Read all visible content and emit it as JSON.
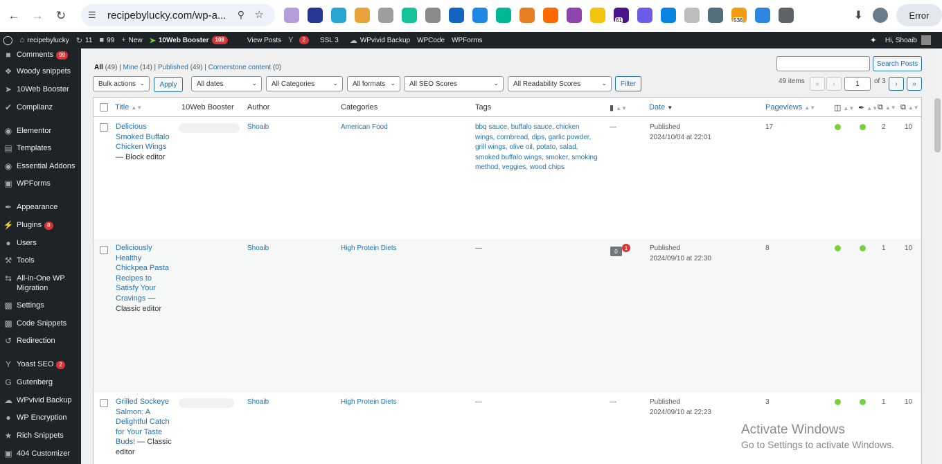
{
  "browser": {
    "url": "recipebylucky.com/wp-a...",
    "error_label": "Error",
    "extensions": [
      {
        "name": "ext-1",
        "color": "#b39ddb"
      },
      {
        "name": "ext-2",
        "color": "#283593"
      },
      {
        "name": "ext-3",
        "color": "#26a6d1"
      },
      {
        "name": "ext-4",
        "color": "#e8a33d"
      },
      {
        "name": "ext-5",
        "color": "#9e9e9e"
      },
      {
        "name": "grammarly",
        "color": "#15c39a"
      },
      {
        "name": "ext-7",
        "color": "#8a8a8a"
      },
      {
        "name": "ext-8",
        "color": "#1565c0"
      },
      {
        "name": "ext-9",
        "color": "#1e88e5"
      },
      {
        "name": "ext-10",
        "color": "#00b894"
      },
      {
        "name": "ext-11",
        "color": "#e67e22"
      },
      {
        "name": "ubersuggest",
        "color": "#ff6a00"
      },
      {
        "name": "ext-13",
        "color": "#8e44ad"
      },
      {
        "name": "ext-14",
        "color": "#f1c40f"
      },
      {
        "name": "ext-15",
        "color": "#4a148c",
        "count": "61"
      },
      {
        "name": "ext-16",
        "color": "#6c5ce7"
      },
      {
        "name": "ext-17",
        "color": "#0984e3"
      },
      {
        "name": "ext-18",
        "color": "#bdbdbd"
      },
      {
        "name": "ext-19",
        "color": "#546e7a"
      },
      {
        "name": "ext-20",
        "color": "#f39c12",
        "count": "536"
      },
      {
        "name": "ext-21",
        "color": "#2e86de"
      },
      {
        "name": "puzzle",
        "color": "#5f6368"
      }
    ]
  },
  "adminbar": {
    "site": "recipebylucky",
    "updates": "11",
    "comments": "99",
    "new": "New",
    "booster": "10Web Booster",
    "booster_count": "108",
    "view_posts": "View Posts",
    "yoast_count": "2",
    "ssl": "SSL 3",
    "wpvivid": "WPvivid Backup",
    "wpcode": "WPCode",
    "wpforms": "WPForms",
    "greeting": "Hi, Shoaib"
  },
  "sidebar": [
    {
      "label": "Comments",
      "badge": "99",
      "icon": "comment-icon"
    },
    {
      "label": "Woody snippets",
      "icon": "snippet-icon"
    },
    {
      "label": "10Web Booster",
      "icon": "booster-icon"
    },
    {
      "label": "Complianz",
      "icon": "check-icon"
    },
    {
      "label": "Elementor",
      "icon": "elementor-icon"
    },
    {
      "label": "Templates",
      "icon": "folder-icon"
    },
    {
      "label": "Essential Addons",
      "icon": "ea-icon"
    },
    {
      "label": "WPForms",
      "icon": "form-icon"
    },
    {
      "label": "Appearance",
      "icon": "brush-icon"
    },
    {
      "label": "Plugins",
      "badge": "8",
      "icon": "plug-icon"
    },
    {
      "label": "Users",
      "icon": "user-icon"
    },
    {
      "label": "Tools",
      "icon": "wrench-icon"
    },
    {
      "label": "All-in-One WP Migration",
      "icon": "migration-icon"
    },
    {
      "label": "Settings",
      "icon": "settings-icon"
    },
    {
      "label": "Code Snippets",
      "icon": "code-icon"
    },
    {
      "label": "Redirection",
      "icon": "redirect-icon"
    },
    {
      "label": "Yoast SEO",
      "badge": "2",
      "icon": "yoast-icon"
    },
    {
      "label": "Gutenberg",
      "icon": "gutenberg-icon"
    },
    {
      "label": "WPvivid Backup",
      "icon": "cloud-icon"
    },
    {
      "label": "WP Encryption",
      "icon": "lock-icon"
    },
    {
      "label": "Rich Snippets",
      "icon": "star-icon"
    },
    {
      "label": "404 Customizer",
      "icon": "page-icon"
    }
  ],
  "filters": {
    "views": [
      {
        "label": "All",
        "count": "(49)"
      },
      {
        "label": "Mine",
        "count": "(14)"
      },
      {
        "label": "Published",
        "count": "(49)"
      },
      {
        "label": "Cornerstone content",
        "count": "(0)"
      }
    ],
    "bulk_actions": "Bulk actions",
    "apply": "Apply",
    "dates": "All dates",
    "categories": "All Categories",
    "formats": "All formats",
    "seo": "All SEO Scores",
    "readability": "All Readability Scores",
    "filter": "Filter",
    "search_button": "Search Posts",
    "items": "49 items",
    "page": "1",
    "of": "of 3",
    "first": "«",
    "prev": "‹",
    "next": "›",
    "last": "»"
  },
  "columns": {
    "title": "Title",
    "booster": "10Web Booster",
    "author": "Author",
    "categories": "Categories",
    "tags": "Tags",
    "date": "Date",
    "pageviews": "Pageviews"
  },
  "posts": [
    {
      "title": "Delicious Smoked Buffalo Chicken Wings",
      "editor": "— Block editor",
      "author": "Shoaib",
      "category": "American Food",
      "tags": "bbq sauce, buffalo sauce, chicken wings, cornbread, dips, garlic powder, grill wings, olive oil, potato, salad, smoked buffalo wings, smoker, smoking method, veggies, wood chips",
      "comments": "—",
      "status": "Published",
      "date": "2024/10/04 at 22:01",
      "pageviews": "17",
      "links_out": "2",
      "links_in": "10"
    },
    {
      "title": "Deliciously Healthy Chickpea Pasta Recipes to Satisfy Your Cravings",
      "editor": "— Classic editor",
      "author": "Shoaib",
      "category": "High Protein Diets",
      "tags": "—",
      "comments": "0",
      "comments_pending": "1",
      "status": "Published",
      "date": "2024/09/10 at 22:30",
      "pageviews": "8",
      "links_out": "1",
      "links_in": "10"
    },
    {
      "title": "Grilled Sockeye Salmon: A Delightful Catch for Your Taste Buds!",
      "editor": "— Classic editor",
      "author": "Shoaib",
      "category": "High Protein Diets",
      "tags": "—",
      "comments": "—",
      "status": "Published",
      "date": "2024/09/10 at 22:23",
      "pageviews": "3",
      "links_out": "1",
      "links_in": "10"
    }
  ],
  "watermark": {
    "line1": "Activate Windows",
    "line2": "Go to Settings to activate Windows."
  }
}
